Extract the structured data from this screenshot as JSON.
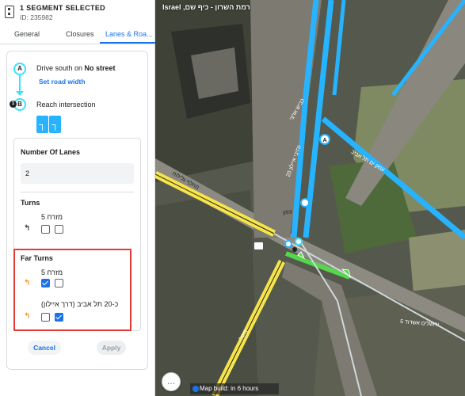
{
  "header": {
    "title": "1 SEGMENT SELECTED",
    "id_text": "ID: 235982"
  },
  "tabs": [
    {
      "label": "General"
    },
    {
      "label": "Closures"
    },
    {
      "label": "Lanes & Roa..."
    }
  ],
  "route": {
    "node_a": "A",
    "node_b": "B",
    "node_b_badge": "1",
    "drive_prefix": "Drive south on ",
    "drive_street": "No street",
    "set_width_link": "Set road width",
    "reach_text": "Reach intersection"
  },
  "lanes": {
    "label": "Number Of Lanes",
    "value": "2"
  },
  "turns": {
    "label": "Turns",
    "rows": [
      {
        "street": "מזרח 5",
        "left_checked": false,
        "right_checked": false
      }
    ]
  },
  "far_turns": {
    "label": "Far Turns",
    "rows": [
      {
        "street": "מזרח 5",
        "left_checked": true,
        "right_checked": false
      },
      {
        "street": "כ-20 תל אביב (דרך איילון)",
        "left_checked": false,
        "right_checked": true
      }
    ]
  },
  "actions": {
    "cancel": "Cancel",
    "apply": "Apply"
  },
  "map": {
    "location": "רמת השרון - כיף שם, Israel",
    "build_status": "Map build: in 6 hours",
    "colors": {
      "highlight": "#26b3ff",
      "primary_road": "#f5e44a",
      "new_segment": "#55d64b",
      "selection_outline": "#e53935"
    },
    "labels": [
      {
        "text": "מחלף גלילות"
      },
      {
        "text": "כביש ארצי"
      },
      {
        "text": "ירושלים אשדוד 5"
      },
      {
        "text": "נתיבי איילון 20"
      },
      {
        "text": "עמק ים תל אביב"
      },
      {
        "text": "צפון"
      },
      {
        "text": "חיפה"
      }
    ]
  }
}
